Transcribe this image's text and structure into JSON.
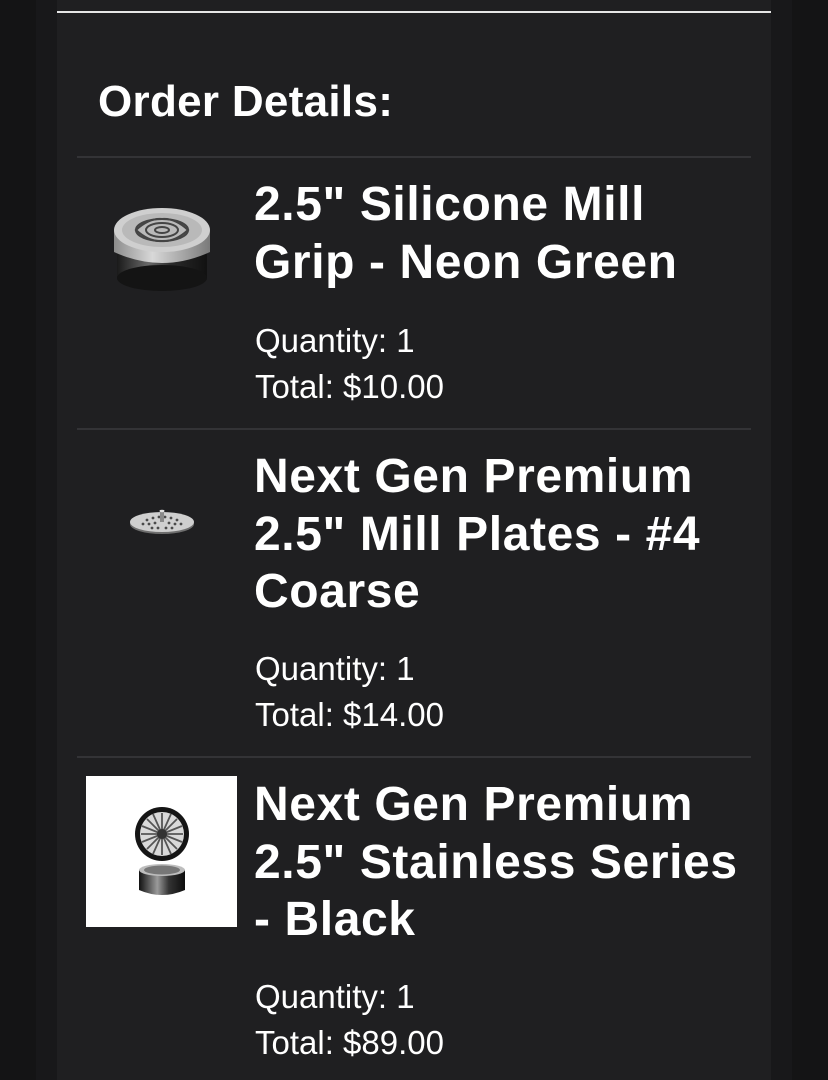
{
  "order": {
    "heading": "Order Details:",
    "items": [
      {
        "name": "2.5\" Silicone Mill Grip - Neon Green",
        "quantity_text": "Quantity: 1",
        "total_text": "Total: $10.00",
        "image_icon": "grinder-grip-icon"
      },
      {
        "name": "Next Gen Premium 2.5\" Mill Plates - #4 Coarse",
        "quantity_text": "Quantity: 1",
        "total_text": "Total: $14.00",
        "image_icon": "mill-plate-icon"
      },
      {
        "name": "Next Gen Premium 2.5\" Stainless Series - Black",
        "quantity_text": "Quantity: 1",
        "total_text": "Total: $89.00",
        "image_icon": "grinder-stainless-icon"
      }
    ]
  },
  "colors": {
    "background": "#141415",
    "card": "#1f1f21",
    "text": "#ffffff",
    "divider": "#333336"
  }
}
